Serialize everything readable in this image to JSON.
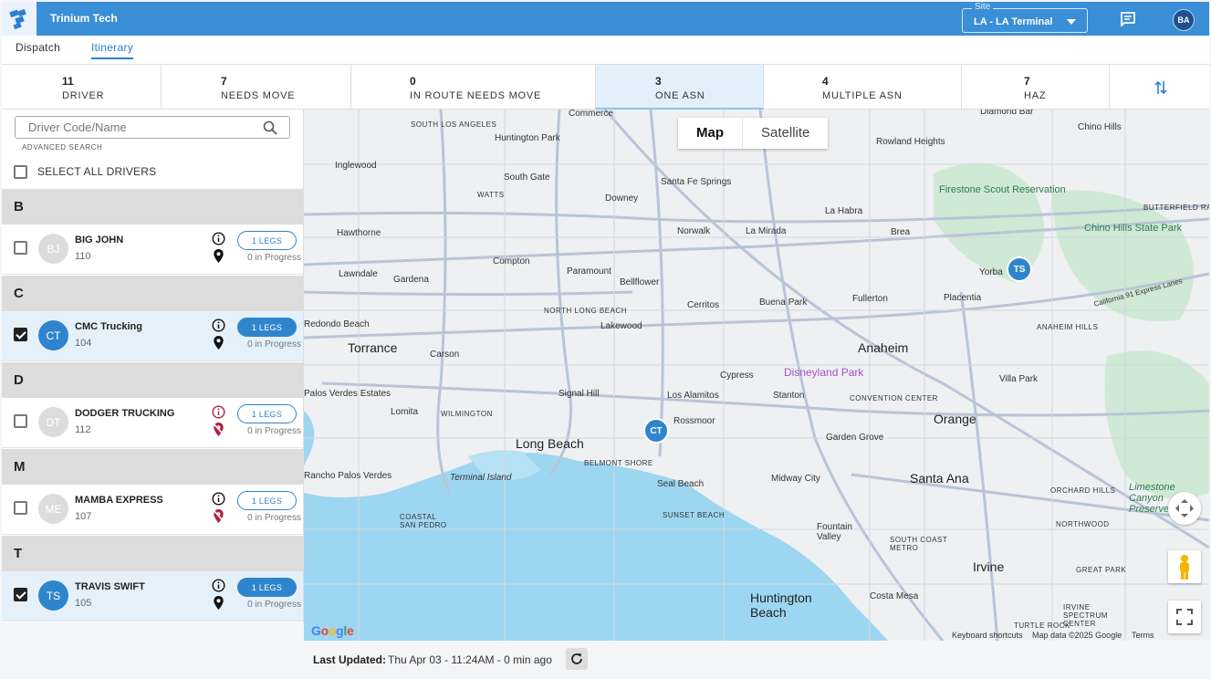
{
  "header": {
    "app_title": "Trinium Tech",
    "site": {
      "legend": "Site",
      "value": "LA - LA Terminal"
    },
    "user_initials": "BA"
  },
  "nav": {
    "tabs": [
      {
        "label": "Dispatch"
      },
      {
        "label": "Itinerary"
      }
    ]
  },
  "stats": [
    {
      "num": "11",
      "label": "DRIVER"
    },
    {
      "num": "7",
      "label": "NEEDS MOVE"
    },
    {
      "num": "0",
      "label": "IN ROUTE NEEDS MOVE"
    },
    {
      "num": "3",
      "label": "ONE ASN"
    },
    {
      "num": "4",
      "label": "MULTIPLE ASN"
    },
    {
      "num": "7",
      "label": "HAZ"
    }
  ],
  "sidebar": {
    "search_placeholder": "Driver Code/Name",
    "advanced_search": "ADVANCED SEARCH",
    "select_all": "SELECT ALL DRIVERS",
    "groups": [
      {
        "letter": "B",
        "driver": {
          "initials": "BJ",
          "name": "BIG JOHN",
          "code": "110",
          "legs": "1 LEGS",
          "progress": "0 in Progress"
        }
      },
      {
        "letter": "C",
        "driver": {
          "initials": "CT",
          "name": "CMC Trucking",
          "code": "104",
          "legs": "1 LEGS",
          "progress": "0 in Progress"
        }
      },
      {
        "letter": "D",
        "driver": {
          "initials": "DT",
          "name": "DODGER TRUCKING",
          "code": "112",
          "legs": "1 LEGS",
          "progress": "0 in Progress"
        }
      },
      {
        "letter": "M",
        "driver": {
          "initials": "ME",
          "name": "MAMBA EXPRESS",
          "code": "107",
          "legs": "1 LEGS",
          "progress": "0 in Progress"
        }
      },
      {
        "letter": "T",
        "driver": {
          "initials": "TS",
          "name": "TRAVIS SWIFT",
          "code": "105",
          "legs": "1 LEGS",
          "progress": "0 in Progress"
        }
      }
    ]
  },
  "map": {
    "type_map": "Map",
    "type_satellite": "Satellite",
    "markers": {
      "ts": "TS",
      "ct": "CT"
    },
    "labels": {
      "commerce": "Commerce",
      "diamond_bar": "Diamond Bar",
      "chino_hills": "Chino Hills",
      "south_la": "SOUTH LOS ANGELES",
      "huntington_park": "Huntington Park",
      "rowland_heights": "Rowland Heights",
      "inglewood": "Inglewood",
      "south_gate": "South Gate",
      "watts": "WATTS",
      "santa_fe_springs": "Santa Fe Springs",
      "downey": "Downey",
      "firestone": "Firestone Scout Reservation",
      "butterfield": "BUTTERFIELD RANCH",
      "hawthorne": "Hawthorne",
      "la_habra": "La Habra",
      "chino_hills_sp": "Chino Hills State Park",
      "norwalk": "Norwalk",
      "la_mirada": "La Mirada",
      "brea": "Brea",
      "compton": "Compton",
      "paramount": "Paramount",
      "lawndale": "Lawndale",
      "gardena": "Gardena",
      "yorba": "Yorba",
      "bellflower": "Bellflower",
      "buena_park": "Buena Park",
      "fullerton": "Fullerton",
      "placentia": "Placentia",
      "north_long_beach": "NORTH LONG BEACH",
      "cerritos": "Cerritos",
      "lakewood": "Lakewood",
      "anaheim_hills": "ANAHEIM HILLS",
      "redondo": "Redondo Beach",
      "torrance": "Torrance",
      "anaheim": "Anaheim",
      "carson": "Carson",
      "cypress": "Cypress",
      "disneyland": "Disneyland Park",
      "villa_park": "Villa Park",
      "palos_verdes": "Palos Verdes Estates",
      "signal_hill": "Signal Hill",
      "los_alamitos": "Los Alamitos",
      "stanton": "Stanton",
      "convention_center": "CONVENTION CENTER",
      "lomita": "Lomita",
      "wilmington": "WILMINGTON",
      "orange": "Orange",
      "rossmoor": "Rossmoor",
      "garden_grove": "Garden Grove",
      "long_beach": "Long Beach",
      "belmont_shore": "BELMONT SHORE",
      "rancho_pv": "Rancho Palos Verdes",
      "terminal_island": "Terminal Island",
      "seal_beach": "Seal Beach",
      "midway_city": "Midway City",
      "santa_ana": "Santa Ana",
      "orchard_hills": "ORCHARD HILLS",
      "limestone": "Limestone Canyon Preserve",
      "sunset_beach": "SUNSET BEACH",
      "coastal_san_pedro": "COASTAL SAN PEDRO",
      "northwood": "NORTHWOOD",
      "fountain_valley": "Fountain Valley",
      "south_coast_metro": "SOUTH COAST METRO",
      "irvine": "Irvine",
      "great_park": "GREAT PARK",
      "huntington_beach": "Huntington Beach",
      "costa_mesa": "Costa Mesa",
      "irvine_spectrum": "IRVINE SPECTRUM CENTER",
      "turtle_rock": "TURTLE ROCK",
      "ca91": "California 91 Express Lanes"
    },
    "google": "Google",
    "keyboard_shortcuts": "Keyboard shortcuts",
    "map_data": "Map data ©2025 Google",
    "terms": "Terms",
    "colors": {
      "water": "#9dd6f0",
      "land": "#eef0f2",
      "park": "#cfe9d4",
      "road": "#b9c4d6"
    }
  },
  "footer": {
    "last_updated_label": "Last Updated:",
    "last_updated_value": "Thu Apr 03 - 11:24AM - 0 min ago"
  }
}
